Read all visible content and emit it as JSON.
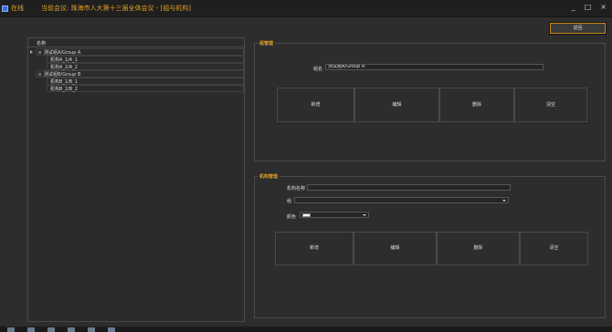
{
  "titlebar": {
    "status": "在线",
    "meeting": "当前会议: 珠海市人大第十三届全体会议 - [组与机构]",
    "controls": [
      "_",
      "□",
      "×"
    ]
  },
  "return_button": "返回",
  "tree": {
    "header": "名称",
    "nodes": [
      {
        "label": "测试组A/Group A",
        "children": [
          "机构A_1/A_1",
          "机构A_2/A_2"
        ]
      },
      {
        "label": "测试组B/Group B",
        "children": [
          "机构B_1/B_1",
          "机构B_2/B_2"
        ]
      }
    ]
  },
  "group_mgmt": {
    "title": "组管理",
    "name_label": "组名",
    "name_value": "测试组A/Group A",
    "buttons": [
      "新增",
      "编辑",
      "删除",
      "清空"
    ]
  },
  "org_mgmt": {
    "title": "机构管理",
    "name_label": "机构名称",
    "name_value": "",
    "group_label": "组",
    "group_value": "",
    "color_label": "颜色",
    "color_value": "#ffffff",
    "buttons": [
      "新增",
      "编辑",
      "删除",
      "清空"
    ]
  },
  "colors": {
    "accent": "#e6a020",
    "background": "#2d2d2d",
    "status": "#3b6fd6"
  }
}
